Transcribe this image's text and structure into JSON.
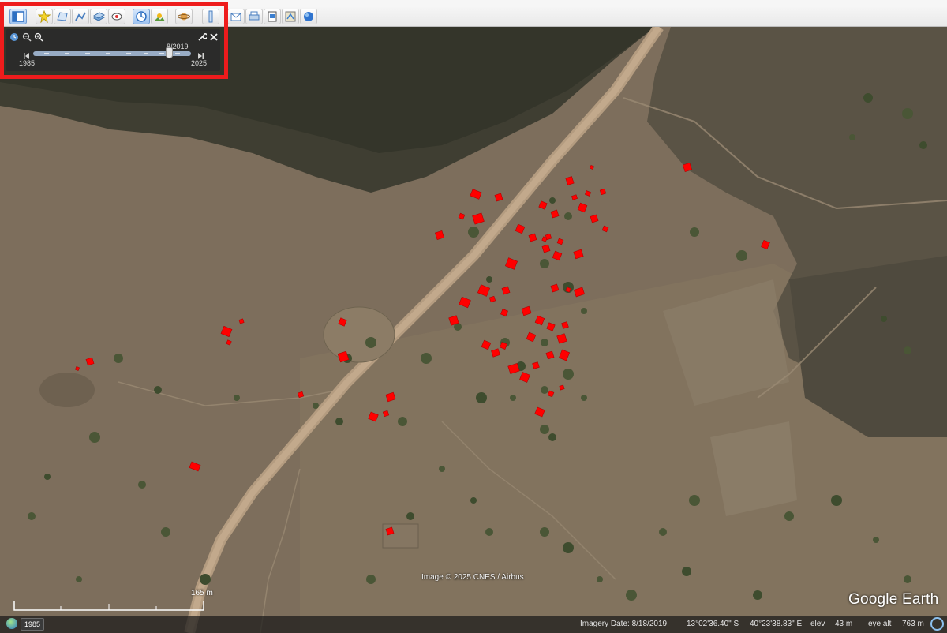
{
  "toolbar": {
    "buttons": [
      {
        "name": "sidebar-toggle-button",
        "icon": "sidebar-icon"
      },
      {
        "name": "add-placemark-button",
        "icon": "placemark-icon"
      },
      {
        "name": "add-polygon-button",
        "icon": "polygon-icon"
      },
      {
        "name": "add-path-button",
        "icon": "path-icon"
      },
      {
        "name": "add-image-overlay-button",
        "icon": "image-overlay-icon"
      },
      {
        "name": "record-tour-button",
        "icon": "record-tour-icon"
      },
      {
        "name": "historical-imagery-button",
        "icon": "clock-icon"
      },
      {
        "name": "sunlight-button",
        "icon": "sunlight-icon"
      },
      {
        "name": "switch-planet-button",
        "icon": "planet-icon"
      },
      {
        "name": "ruler-button",
        "icon": "ruler-icon"
      },
      {
        "name": "email-button",
        "icon": "email-icon"
      },
      {
        "name": "print-button",
        "icon": "print-icon"
      },
      {
        "name": "save-image-button",
        "icon": "save-image-icon"
      },
      {
        "name": "view-in-maps-button",
        "icon": "maps-icon"
      },
      {
        "name": "earth-view-button",
        "icon": "globe-icon"
      }
    ]
  },
  "time_slider": {
    "current_date": "8/2019",
    "start_year": "1985",
    "end_year": "2025",
    "position": 0.86
  },
  "map": {
    "attribution": "Image © 2025 CNES / Airbus",
    "logo": "Google Earth",
    "scale_label": "165 m"
  },
  "status_bar": {
    "year_badge": "1985",
    "imagery_date": "Imagery Date: 8/18/2019",
    "latitude": "13°02'36.40\" S",
    "longitude": "40°23'38.83\" E",
    "elev_label": "elev",
    "elev_value": "43 m",
    "eye_alt_label": "eye alt",
    "eye_alt_value": "763 m"
  },
  "colors": {
    "highlight_box": "#ee1c1c",
    "building_marker": "#ff0000",
    "terrain": "#7a6b5a",
    "road": "#c2a98c"
  }
}
